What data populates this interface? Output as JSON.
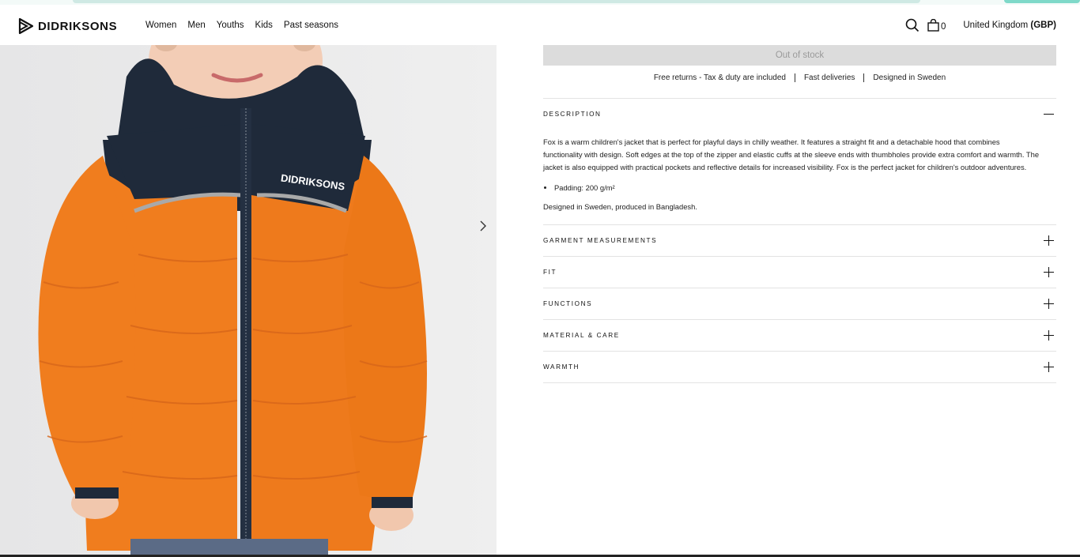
{
  "brand": {
    "name": "DIDRIKSONS"
  },
  "nav": {
    "items": [
      "Women",
      "Men",
      "Youths",
      "Kids",
      "Past seasons"
    ]
  },
  "header": {
    "cart_count": "0",
    "country": "United Kingdom",
    "currency": "(GBP)"
  },
  "product": {
    "stock_button": "Out of stock",
    "usps": [
      "Free returns - Tax & duty are included",
      "Fast deliveries",
      "Designed in Sweden"
    ],
    "jacket_logo": "DIDRIKSONS"
  },
  "accordion": {
    "description": {
      "title": "DESCRIPTION",
      "text": "Fox is a warm children's jacket that is perfect for playful days in chilly weather. It features a straight fit and a detachable hood that combines functionality with design. Soft edges at the top of the zipper and elastic cuffs at the sleeve ends with thumbholes provide extra comfort and warmth. The jacket is also equipped with practical pockets and reflective details for increased visibility. Fox is the perfect jacket for children's outdoor adventures.",
      "bullet": "Padding: 200 g/m²",
      "origin": "Designed in Sweden, produced in Bangladesh."
    },
    "sections": [
      "GARMENT MEASUREMENTS",
      "FIT",
      "FUNCTIONS",
      "MATERIAL & CARE",
      "WARMTH"
    ]
  },
  "colors": {
    "accent_strip": "#7fd9c9",
    "jacket_orange": "#f07d1e",
    "jacket_navy": "#1f2a3a",
    "disabled_button": "#dcdcdc"
  }
}
